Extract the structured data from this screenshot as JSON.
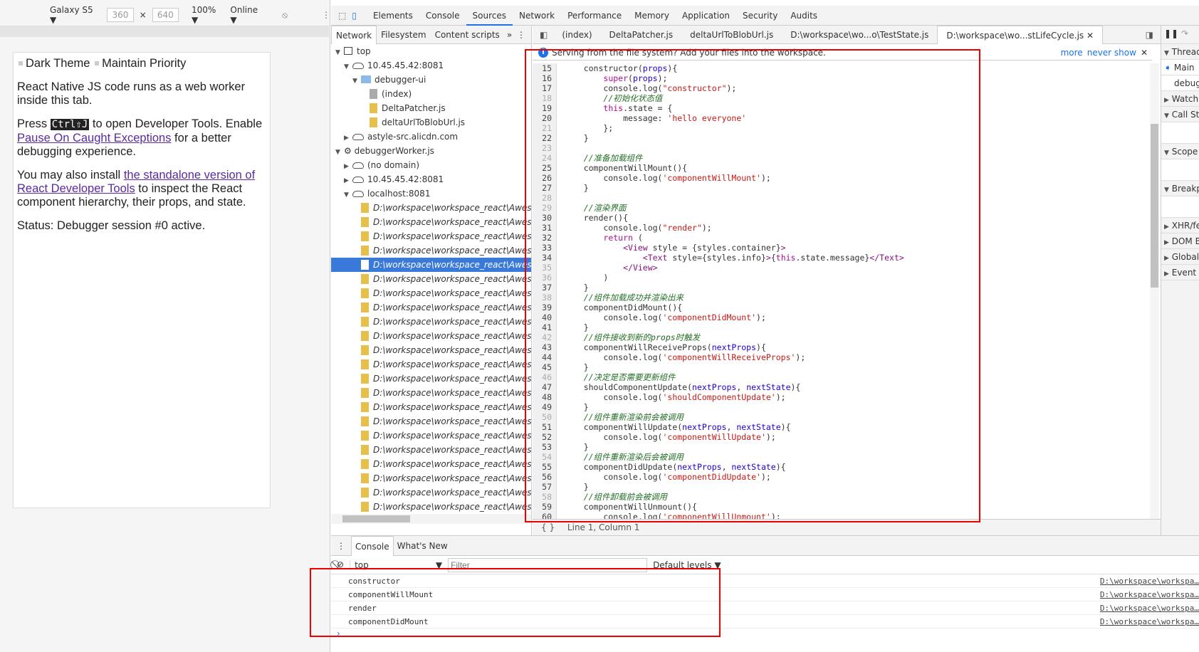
{
  "device_toolbar": {
    "device": "Galaxy S5",
    "width": "360",
    "x": "×",
    "height": "640",
    "zoom": "100%",
    "network": "Online"
  },
  "page": {
    "checkbox1": "Dark Theme",
    "checkbox2": "Maintain Priority",
    "p1": "React Native JS code runs as a web worker inside this tab.",
    "p2_a": "Press ",
    "p2_kbd": "Ctrl⇧J",
    "p2_b": " to open Developer Tools. Enable ",
    "p2_link": "Pause On Caught Exceptions",
    "p2_c": " for a better debugging experience.",
    "p3_a": "You may also install ",
    "p3_link": "the standalone version of React Developer Tools",
    "p3_b": " to inspect the React component hierarchy, their props, and state.",
    "p4": "Status: Debugger session #0 active."
  },
  "main_tabs": [
    "Elements",
    "Console",
    "Sources",
    "Network",
    "Performance",
    "Memory",
    "Application",
    "Security",
    "Audits"
  ],
  "active_main_tab": "Sources",
  "navigator": {
    "tabs": [
      "Network",
      "Filesystem",
      "Content scripts"
    ],
    "more": "»",
    "tree": [
      {
        "label": "top",
        "indent": 0,
        "icon": "frame",
        "arrow": "▼"
      },
      {
        "label": "10.45.45.42:8081",
        "indent": 1,
        "icon": "cloud",
        "arrow": "▼"
      },
      {
        "label": "debugger-ui",
        "indent": 2,
        "icon": "folder",
        "arrow": "▼"
      },
      {
        "label": "(index)",
        "indent": 3,
        "icon": "file-gray",
        "arrow": ""
      },
      {
        "label": "DeltaPatcher.js",
        "indent": 3,
        "icon": "file",
        "arrow": ""
      },
      {
        "label": "deltaUrlToBlobUrl.js",
        "indent": 3,
        "icon": "file",
        "arrow": ""
      },
      {
        "label": "astyle-src.alicdn.com",
        "indent": 1,
        "icon": "cloud",
        "arrow": "▶"
      },
      {
        "label": "debuggerWorker.js",
        "indent": 0,
        "icon": "gear",
        "arrow": "▼"
      },
      {
        "label": "(no domain)",
        "indent": 1,
        "icon": "cloud",
        "arrow": "▶"
      },
      {
        "label": "10.45.45.42:8081",
        "indent": 1,
        "icon": "cloud",
        "arrow": "▶"
      },
      {
        "label": "localhost:8081",
        "indent": 1,
        "icon": "cloud",
        "arrow": "▼"
      }
    ],
    "file_label": "D:\\workspace\\workspace_react\\AwesomeProject",
    "file_count": 23,
    "selected_file_index": 4
  },
  "editor": {
    "tabs": [
      "(index)",
      "DeltaPatcher.js",
      "deltaUrlToBlobUrl.js",
      "D:\\workspace\\wo...o\\TestState.js",
      "D:\\workspace\\wo...stLifeCycle.js"
    ],
    "active_tab": 4,
    "infobar": {
      "text": "Serving from the file system? Add your files into the workspace.",
      "more": "more",
      "never_show": "never show"
    },
    "status": "Line 1, Column 1",
    "lines": [
      {
        "n": 15,
        "t": [
          [
            "t",
            "    constructor("
          ],
          [
            "v",
            "props"
          ],
          [
            "t",
            "){"
          ]
        ]
      },
      {
        "n": 16,
        "t": [
          [
            "t",
            "        "
          ],
          [
            "k",
            "super"
          ],
          [
            "t",
            "("
          ],
          [
            "v",
            "props"
          ],
          [
            "t",
            ");"
          ]
        ]
      },
      {
        "n": 17,
        "t": [
          [
            "t",
            "        console.log("
          ],
          [
            "s",
            "\"constructor\""
          ],
          [
            "t",
            ");"
          ]
        ]
      },
      {
        "n": 18,
        "dim": true,
        "t": [
          [
            "t",
            "        "
          ],
          [
            "c",
            "//初始化状态值"
          ]
        ]
      },
      {
        "n": 19,
        "t": [
          [
            "t",
            "        "
          ],
          [
            "k",
            "this"
          ],
          [
            "t",
            ".state = {"
          ]
        ]
      },
      {
        "n": 20,
        "t": [
          [
            "t",
            "            message: "
          ],
          [
            "s",
            "'hello everyone'"
          ]
        ]
      },
      {
        "n": 21,
        "dim": true,
        "t": [
          [
            "t",
            "        };"
          ]
        ]
      },
      {
        "n": 22,
        "t": [
          [
            "t",
            "    }"
          ]
        ]
      },
      {
        "n": 23,
        "dim": true,
        "t": []
      },
      {
        "n": 24,
        "dim": true,
        "t": [
          [
            "t",
            "    "
          ],
          [
            "c",
            "//准备加载组件"
          ]
        ]
      },
      {
        "n": 25,
        "t": [
          [
            "t",
            "    componentWillMount(){"
          ]
        ]
      },
      {
        "n": 26,
        "t": [
          [
            "t",
            "        console.log("
          ],
          [
            "s",
            "'componentWillMount'"
          ],
          [
            "t",
            ");"
          ]
        ]
      },
      {
        "n": 27,
        "t": [
          [
            "t",
            "    }"
          ]
        ]
      },
      {
        "n": 28,
        "dim": true,
        "t": []
      },
      {
        "n": 29,
        "dim": true,
        "t": [
          [
            "t",
            "    "
          ],
          [
            "c",
            "//渲染界面"
          ]
        ]
      },
      {
        "n": 30,
        "t": [
          [
            "t",
            "    render(){"
          ]
        ]
      },
      {
        "n": 31,
        "t": [
          [
            "t",
            "        console.log("
          ],
          [
            "s",
            "\"render\""
          ],
          [
            "t",
            ");"
          ]
        ]
      },
      {
        "n": 32,
        "t": [
          [
            "t",
            "        "
          ],
          [
            "k",
            "return"
          ],
          [
            "t",
            " ("
          ]
        ]
      },
      {
        "n": 33,
        "t": [
          [
            "t",
            "            "
          ],
          [
            "g",
            "<View"
          ],
          [
            "t",
            " style = {styles.container}"
          ],
          [
            "g",
            ">"
          ]
        ]
      },
      {
        "n": 34,
        "t": [
          [
            "t",
            "                "
          ],
          [
            "g",
            "<Text"
          ],
          [
            "t",
            " style={styles.info}"
          ],
          [
            "g",
            ">"
          ],
          [
            "t",
            "{"
          ],
          [
            "k",
            "this"
          ],
          [
            "t",
            ".state.message}"
          ],
          [
            "g",
            "</Text>"
          ]
        ]
      },
      {
        "n": 35,
        "dim": true,
        "t": [
          [
            "t",
            "            "
          ],
          [
            "g",
            "</View>"
          ]
        ]
      },
      {
        "n": 36,
        "dim": true,
        "t": [
          [
            "t",
            "        )"
          ]
        ]
      },
      {
        "n": 37,
        "t": [
          [
            "t",
            "    }"
          ]
        ]
      },
      {
        "n": 38,
        "dim": true,
        "t": [
          [
            "t",
            "    "
          ],
          [
            "c",
            "//组件加载成功并渲染出来"
          ]
        ]
      },
      {
        "n": 39,
        "t": [
          [
            "t",
            "    componentDidMount(){"
          ]
        ]
      },
      {
        "n": 40,
        "t": [
          [
            "t",
            "        console.log("
          ],
          [
            "s",
            "'componentDidMount'"
          ],
          [
            "t",
            ");"
          ]
        ]
      },
      {
        "n": 41,
        "t": [
          [
            "t",
            "    }"
          ]
        ]
      },
      {
        "n": 42,
        "dim": true,
        "t": [
          [
            "t",
            "    "
          ],
          [
            "c",
            "//组件接收到新的props时触发"
          ]
        ]
      },
      {
        "n": 43,
        "t": [
          [
            "t",
            "    componentWillReceiveProps("
          ],
          [
            "v",
            "nextProps"
          ],
          [
            "t",
            "){"
          ]
        ]
      },
      {
        "n": 44,
        "t": [
          [
            "t",
            "        console.log("
          ],
          [
            "s",
            "'componentWillReceiveProps'"
          ],
          [
            "t",
            ");"
          ]
        ]
      },
      {
        "n": 45,
        "t": [
          [
            "t",
            "    }"
          ]
        ]
      },
      {
        "n": 46,
        "dim": true,
        "t": [
          [
            "t",
            "    "
          ],
          [
            "c",
            "//决定是否需要更新组件"
          ]
        ]
      },
      {
        "n": 47,
        "t": [
          [
            "t",
            "    shouldComponentUpdate("
          ],
          [
            "v",
            "nextProps"
          ],
          [
            "t",
            ", "
          ],
          [
            "v",
            "nextState"
          ],
          [
            "t",
            "){"
          ]
        ]
      },
      {
        "n": 48,
        "t": [
          [
            "t",
            "        console.log("
          ],
          [
            "s",
            "'shouldComponentUpdate'"
          ],
          [
            "t",
            ");"
          ]
        ]
      },
      {
        "n": 49,
        "t": [
          [
            "t",
            "    }"
          ]
        ]
      },
      {
        "n": 50,
        "dim": true,
        "t": [
          [
            "t",
            "    "
          ],
          [
            "c",
            "//组件重新渲染前会被调用"
          ]
        ]
      },
      {
        "n": 51,
        "t": [
          [
            "t",
            "    componentWillUpdate("
          ],
          [
            "v",
            "nextProps"
          ],
          [
            "t",
            ", "
          ],
          [
            "v",
            "nextState"
          ],
          [
            "t",
            "){"
          ]
        ]
      },
      {
        "n": 52,
        "t": [
          [
            "t",
            "        console.log("
          ],
          [
            "s",
            "'componentWillUpdate'"
          ],
          [
            "t",
            ");"
          ]
        ]
      },
      {
        "n": 53,
        "t": [
          [
            "t",
            "    }"
          ]
        ]
      },
      {
        "n": 54,
        "dim": true,
        "t": [
          [
            "t",
            "    "
          ],
          [
            "c",
            "//组件重新渲染后会被调用"
          ]
        ]
      },
      {
        "n": 55,
        "t": [
          [
            "t",
            "    componentDidUpdate("
          ],
          [
            "v",
            "nextProps"
          ],
          [
            "t",
            ", "
          ],
          [
            "v",
            "nextState"
          ],
          [
            "t",
            "){"
          ]
        ]
      },
      {
        "n": 56,
        "t": [
          [
            "t",
            "        console.log("
          ],
          [
            "s",
            "'componentDidUpdate'"
          ],
          [
            "t",
            ");"
          ]
        ]
      },
      {
        "n": 57,
        "t": [
          [
            "t",
            "    }"
          ]
        ]
      },
      {
        "n": 58,
        "dim": true,
        "t": [
          [
            "t",
            "    "
          ],
          [
            "c",
            "//组件卸载前会被调用"
          ]
        ]
      },
      {
        "n": 59,
        "t": [
          [
            "t",
            "    componentWillUnmount(){"
          ]
        ]
      },
      {
        "n": 60,
        "t": [
          [
            "t",
            "        console.log("
          ],
          [
            "s",
            "'componentWillUnmount'"
          ],
          [
            "t",
            ");"
          ]
        ]
      }
    ]
  },
  "sidebar": {
    "sections": [
      "Threads",
      "Main",
      "debuggerWorker",
      "Watch",
      "Call Stack",
      "Scope",
      "Breakpoints",
      "XHR/fetch Breakpoints",
      "DOM Breakpoints",
      "Global Listeners",
      "Event Listener Breakpoints"
    ]
  },
  "drawer": {
    "tabs": [
      "Console",
      "What's New"
    ],
    "context": "top",
    "filter_placeholder": "Filter",
    "levels": "Default levels",
    "messages": [
      "constructor",
      "componentWillMount",
      "render",
      "componentDidMount"
    ],
    "source": "D:\\workspace\\workspa…",
    "prompt": "›"
  },
  "colors": {
    "accent": "#1a73e8",
    "selection": "#3879d9",
    "highlight_box": "#e00000"
  }
}
